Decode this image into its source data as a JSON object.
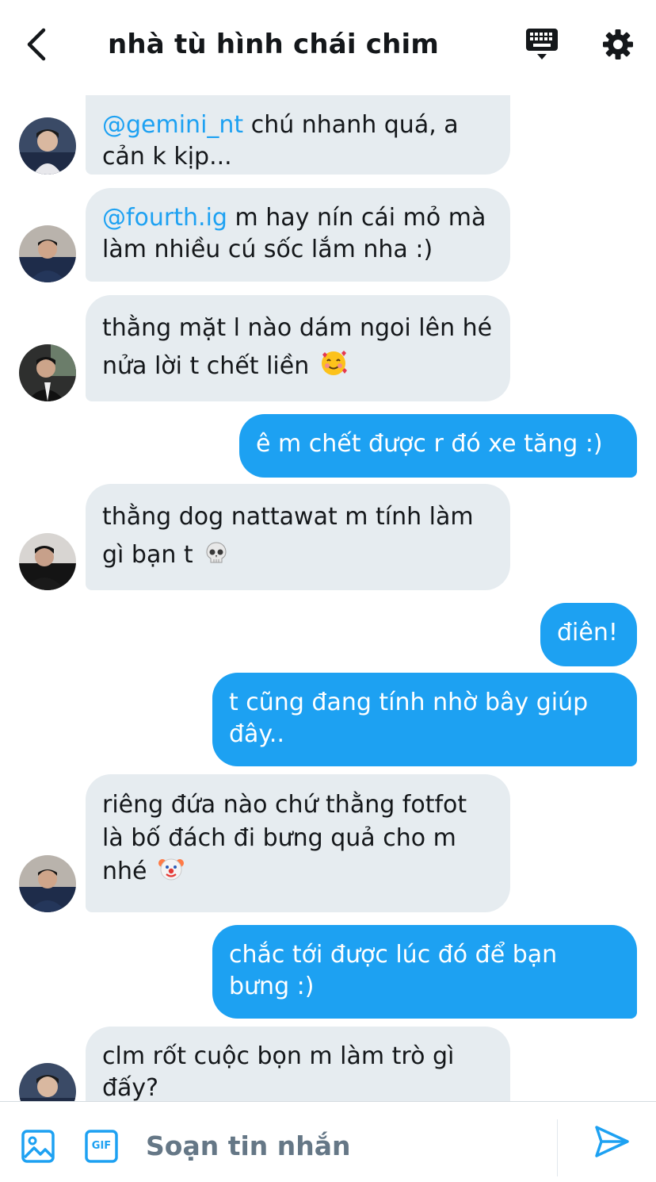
{
  "header": {
    "title": "nhà tù hình chái chim"
  },
  "messages": [
    {
      "dir": "in",
      "mention": "@gemini_nt",
      "text": " chú nhanh quá, a cản k kịp..."
    },
    {
      "dir": "in",
      "mention": "@fourth.ig",
      "text": " m hay nín cái mỏ mà làm nhiều cú sốc lắm nha :)"
    },
    {
      "dir": "in",
      "text": "thằng mặt l nào dám ngoi lên hé nửa lời t chết liền",
      "emoji": "smiling-face-with-hearts"
    },
    {
      "dir": "out",
      "text": "ê m chết được r đó xe tăng :)"
    },
    {
      "dir": "in",
      "text": "thằng dog nattawat m tính làm gì bạn t",
      "emoji": "skull"
    },
    {
      "dir": "out",
      "text": "điên!"
    },
    {
      "dir": "out",
      "text": "t cũng đang tính nhờ bây giúp đây.."
    },
    {
      "dir": "in",
      "text": "riêng đứa nào chứ thằng fotfot là bố đách đi bưng quả cho m nhé",
      "emoji": "clown-face"
    },
    {
      "dir": "out",
      "text": "chắc tới được lúc đó để bạn bưng :)"
    },
    {
      "dir": "in",
      "text": "clm rốt cuộc bọn m làm trò gì đấy?"
    }
  ],
  "composer": {
    "placeholder": "Soạn tin nhắn",
    "gif_label": "GIF"
  },
  "colors": {
    "accent": "#1da1f2",
    "incoming_bubble": "#e6ecf0",
    "text": "#14171a",
    "muted": "#657786"
  }
}
